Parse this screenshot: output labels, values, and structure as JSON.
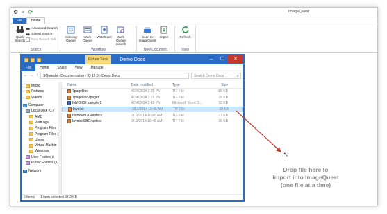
{
  "app": {
    "title": "ImageQuest",
    "tabs": [
      "File",
      "Home"
    ]
  },
  "ribbon": {
    "search_group": {
      "label": "Search",
      "quick_search": "Quick Search",
      "advanced_search": "Advanced Search",
      "saved_search": "Saved Search",
      "new_search_tab": "New Search Tab"
    },
    "workflow_group": {
      "label": "Workflow",
      "indexing_queue": "Indexing Queue",
      "work_queue": "Work Queue",
      "watch_list": "Watch List",
      "work_queue_search": "Work Queue Search"
    },
    "new_document_group": {
      "label": "New Document",
      "scan": "Scan to ImageQuest",
      "import": "Import"
    },
    "view_group": {
      "label": "View",
      "refresh": "Refresh"
    }
  },
  "explorer": {
    "title": "Demo Docs",
    "context_tab": "Picture Tools",
    "tabs": [
      "File",
      "Home",
      "Share",
      "View",
      "Manage"
    ],
    "address": "SQureshi  ›  Documentation  ›  IQ 12.0  ›  Demo Docs",
    "search_placeholder": "Search Demo Docs",
    "nav": [
      "Music",
      "Pictures",
      "Videos",
      "Computer",
      "Local Disk (C:)",
      "AMD",
      "PerfLogs",
      "Program Files",
      "Program Files (",
      "Users",
      "Virtual Machin",
      "Windows",
      "User Folders (\\",
      "Public Folders (K",
      "Network"
    ],
    "columns": [
      "Name",
      "Date modified",
      "Type",
      "Size"
    ],
    "files": [
      {
        "name": "7pageDoc",
        "date": "4/24/2014 2:25 PM",
        "type": "TIF File",
        "size": "85 KB"
      },
      {
        "name": "7pageDoc2pager",
        "date": "4/24/2014 2:25 PM",
        "type": "TIF File",
        "size": "28 KB"
      },
      {
        "name": "INVOICE sample 1",
        "date": "4/24/2014 2:40 PM",
        "type": "Microsoft Word D...",
        "size": "32 KB"
      },
      {
        "name": "Invoice",
        "date": "3/11/2014 10:45 AM",
        "type": "TIF File",
        "size": "39 KB"
      },
      {
        "name": "InvoiceBGGraphics",
        "date": "3/11/2014 10:45 AM",
        "type": "TIF File",
        "size": "37 KB"
      },
      {
        "name": "InvoiceSBGraphics",
        "date": "3/11/2014 10:45 AM",
        "type": "TIF File",
        "size": "36 KB"
      }
    ],
    "status": {
      "items": "6 items",
      "selected": "1 item selected  38.2 KB"
    }
  },
  "drop_hint": {
    "line1": "Drop file here to",
    "line2": "import into ImageQuest",
    "line3": "(one file at a time)"
  }
}
